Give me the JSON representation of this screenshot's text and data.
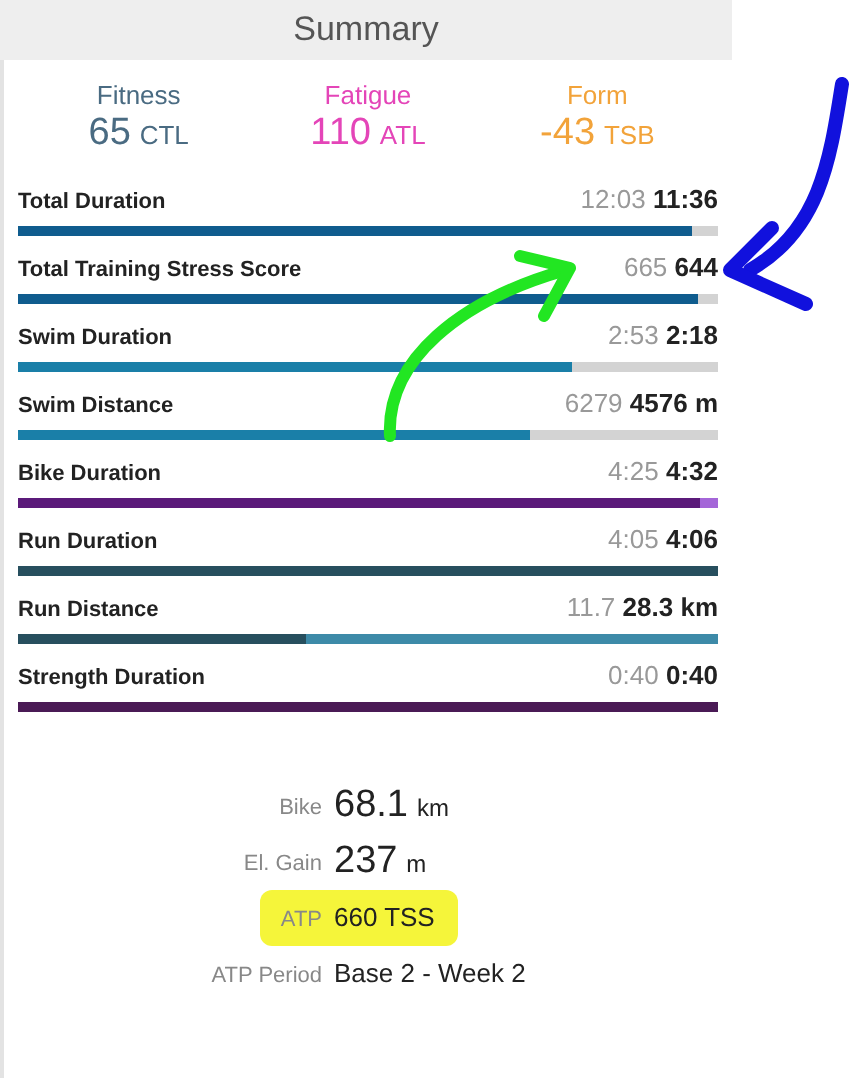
{
  "header": {
    "title": "Summary"
  },
  "fitness": [
    {
      "label": "Fitness",
      "value": "65",
      "unit": "CTL",
      "color": "#4a6b82"
    },
    {
      "label": "Fatigue",
      "value": "110",
      "unit": "ATL",
      "color": "#e445b8"
    },
    {
      "label": "Form",
      "value": "-43",
      "unit": "TSB",
      "color": "#f2a33a"
    }
  ],
  "metrics": [
    {
      "label": "Total Duration",
      "planned": "12:03",
      "actual": "11:36",
      "level": 0.962,
      "color": "#0f5c8e",
      "track": {
        "color": "#d3d3d3"
      }
    },
    {
      "label": "Total Training Stress Score",
      "planned": "665",
      "actual": "644",
      "level": 0.97,
      "color": "#0f5c8e",
      "track": {
        "color": "#d3d3d3"
      }
    },
    {
      "label": "Swim Duration",
      "planned": "2:53",
      "actual": "2:18",
      "level": 0.79,
      "color": "#1a7fa8",
      "track": {
        "color": "#d3d3d3"
      }
    },
    {
      "label": "Swim Distance",
      "planned": "6279",
      "actual": "4576 m",
      "level": 0.73,
      "color": "#1a7fa8",
      "track": {
        "color": "#d3d3d3"
      }
    },
    {
      "label": "Bike Duration",
      "planned": "4:25",
      "actual": "4:32",
      "level": 0.975,
      "color": "#5b1a7a",
      "track": {
        "color": "#a466d8"
      }
    },
    {
      "label": "Run Duration",
      "planned": "4:05",
      "actual": "4:06",
      "color": "#274f5e"
    },
    {
      "label": "Run Distance",
      "planned": "11.7",
      "actual": "28.3 km",
      "level": 0.41,
      "color": "#274f5e",
      "track": {
        "color": "#3d8aa8"
      }
    },
    {
      "label": "Strength Duration",
      "planned": "0:40",
      "actual": "0:40",
      "color": "#4a1a55"
    }
  ],
  "stats": [
    {
      "label": "Bike",
      "value": "68.1",
      "unit": "km",
      "kind": "big",
      "highlighted": false
    },
    {
      "label": "El. Gain",
      "value": "237",
      "unit": "m",
      "kind": "big",
      "highlighted": false
    },
    {
      "label": "ATP",
      "value": "660 TSS",
      "kind": "plain",
      "highlighted": true
    },
    {
      "label": "ATP Period",
      "value": "Base 2 - Week 2",
      "kind": "plain",
      "highlighted": false
    }
  ]
}
